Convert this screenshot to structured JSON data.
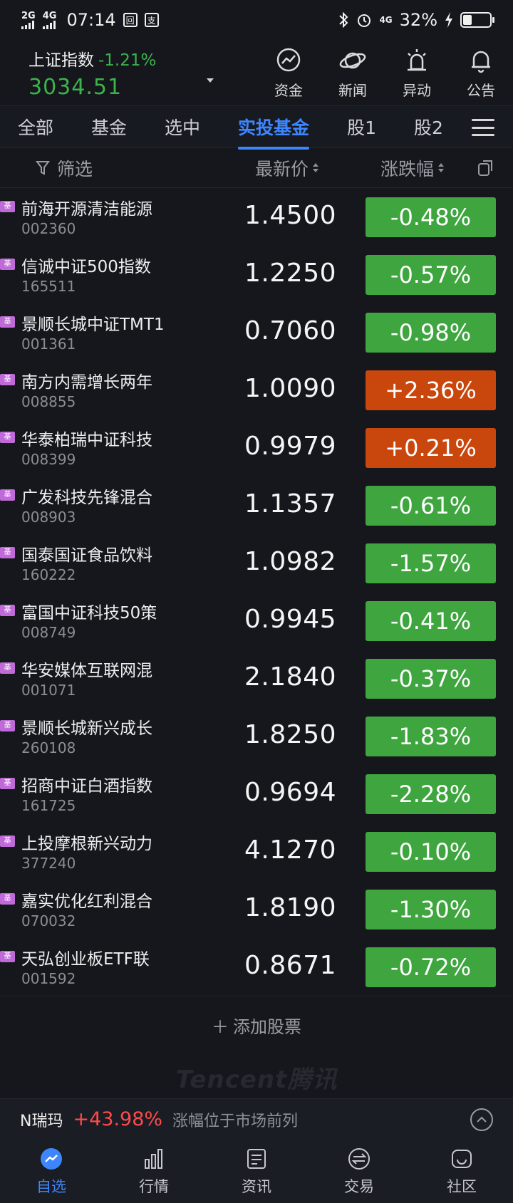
{
  "status": {
    "net1": "2G",
    "net2": "4G",
    "time": "07:14",
    "battery": "32%",
    "battery_level": 0.32
  },
  "header": {
    "index_name": "上证指数",
    "index_change": "-1.21%",
    "index_value": "3034.51",
    "actions": [
      {
        "label": "资金",
        "icon": "fund-chart-icon"
      },
      {
        "label": "新闻",
        "icon": "planet-icon"
      },
      {
        "label": "异动",
        "icon": "alarm-light-icon"
      },
      {
        "label": "公告",
        "icon": "bell-icon"
      }
    ]
  },
  "tabs": [
    "全部",
    "基金",
    "选中",
    "实投基金",
    "股1",
    "股2"
  ],
  "active_tab": "实投基金",
  "columns": {
    "filter": "筛选",
    "price": "最新价",
    "change": "涨跌幅"
  },
  "funds": [
    {
      "badge": "基",
      "name": "前海开源清洁能源",
      "code": "002360",
      "price": "1.4500",
      "change": "-0.48%",
      "dir": "down"
    },
    {
      "badge": "基",
      "name": "信诚中证500指数",
      "code": "165511",
      "price": "1.2250",
      "change": "-0.57%",
      "dir": "down"
    },
    {
      "badge": "基",
      "name": "景顺长城中证TMT1",
      "code": "001361",
      "price": "0.7060",
      "change": "-0.98%",
      "dir": "down"
    },
    {
      "badge": "基",
      "name": "南方内需增长两年",
      "code": "008855",
      "price": "1.0090",
      "change": "+2.36%",
      "dir": "up"
    },
    {
      "badge": "基",
      "name": "华泰柏瑞中证科技",
      "code": "008399",
      "price": "0.9979",
      "change": "+0.21%",
      "dir": "up"
    },
    {
      "badge": "基",
      "name": "广发科技先锋混合",
      "code": "008903",
      "price": "1.1357",
      "change": "-0.61%",
      "dir": "down"
    },
    {
      "badge": "基",
      "name": "国泰国证食品饮料",
      "code": "160222",
      "price": "1.0982",
      "change": "-1.57%",
      "dir": "down"
    },
    {
      "badge": "基",
      "name": "富国中证科技50策",
      "code": "008749",
      "price": "0.9945",
      "change": "-0.41%",
      "dir": "down"
    },
    {
      "badge": "基",
      "name": "华安媒体互联网混",
      "code": "001071",
      "price": "2.1840",
      "change": "-0.37%",
      "dir": "down"
    },
    {
      "badge": "基",
      "name": "景顺长城新兴成长",
      "code": "260108",
      "price": "1.8250",
      "change": "-1.83%",
      "dir": "down"
    },
    {
      "badge": "基",
      "name": "招商中证白酒指数",
      "code": "161725",
      "price": "0.9694",
      "change": "-2.28%",
      "dir": "down"
    },
    {
      "badge": "基",
      "name": "上投摩根新兴动力",
      "code": "377240",
      "price": "4.1270",
      "change": "-0.10%",
      "dir": "down"
    },
    {
      "badge": "基",
      "name": "嘉实优化红利混合",
      "code": "070032",
      "price": "1.8190",
      "change": "-1.30%",
      "dir": "down"
    },
    {
      "badge": "基",
      "name": "天弘创业板ETF联",
      "code": "001592",
      "price": "0.8671",
      "change": "-0.72%",
      "dir": "down"
    }
  ],
  "add_stock": "添加股票",
  "watermark": "Tencent腾讯",
  "ticker": {
    "name": "N瑞玛",
    "change": "+43.98%",
    "desc": "涨幅位于市场前列"
  },
  "bottom_nav": [
    {
      "label": "自选",
      "icon": "favorites-icon",
      "active": true
    },
    {
      "label": "行情",
      "icon": "bar-chart-icon",
      "active": false
    },
    {
      "label": "资讯",
      "icon": "news-icon",
      "active": false
    },
    {
      "label": "交易",
      "icon": "exchange-icon",
      "active": false
    },
    {
      "label": "社区",
      "icon": "community-icon",
      "active": false
    }
  ],
  "colors": {
    "up": "#c9460d",
    "down": "#3ea53f",
    "accent": "#3d86ff",
    "ticker_up": "#ff4a4a"
  }
}
